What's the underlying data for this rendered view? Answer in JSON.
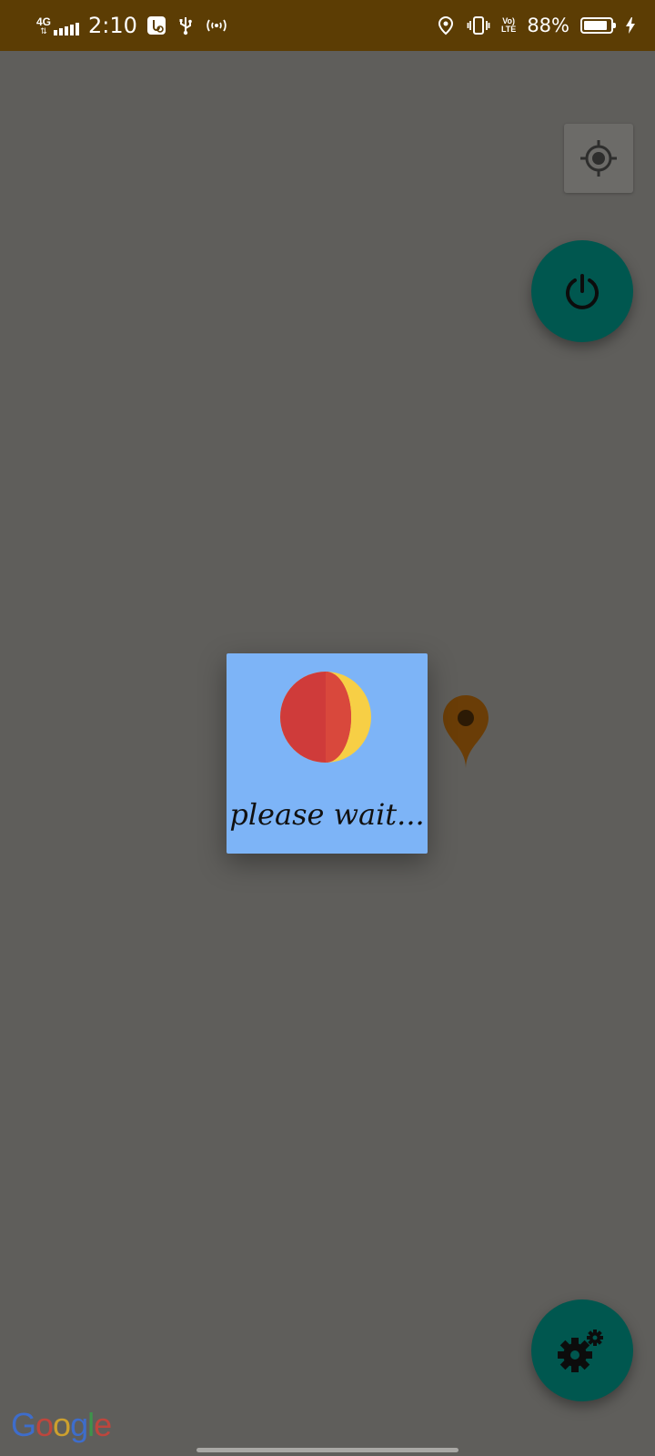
{
  "status_bar": {
    "network_type": "4G",
    "time": "2:10",
    "battery_percent": "88%",
    "battery_level": 0.88,
    "volte_top": "Vo)",
    "volte_bottom": "LTE",
    "icons": [
      "signal-icon",
      "usb-debug-icon",
      "usb-icon",
      "hotspot-icon",
      "location-icon",
      "vibrate-icon",
      "volte-icon",
      "battery-icon",
      "charging-icon"
    ],
    "background_color": "#5c3d04"
  },
  "map": {
    "background_color": "#5f5e5b",
    "locate_button_icon": "my-location-icon",
    "power_button_icon": "power-icon",
    "settings_button_icon": "settings-gears-icon",
    "fab_color": "#00574f",
    "marker_color": "#6a3d07",
    "attribution_logo": "Google"
  },
  "dialog": {
    "message": "please wait...",
    "background_color": "#7db4f7",
    "spinner_colors": [
      "#d13b3b",
      "#f7cf45"
    ]
  }
}
